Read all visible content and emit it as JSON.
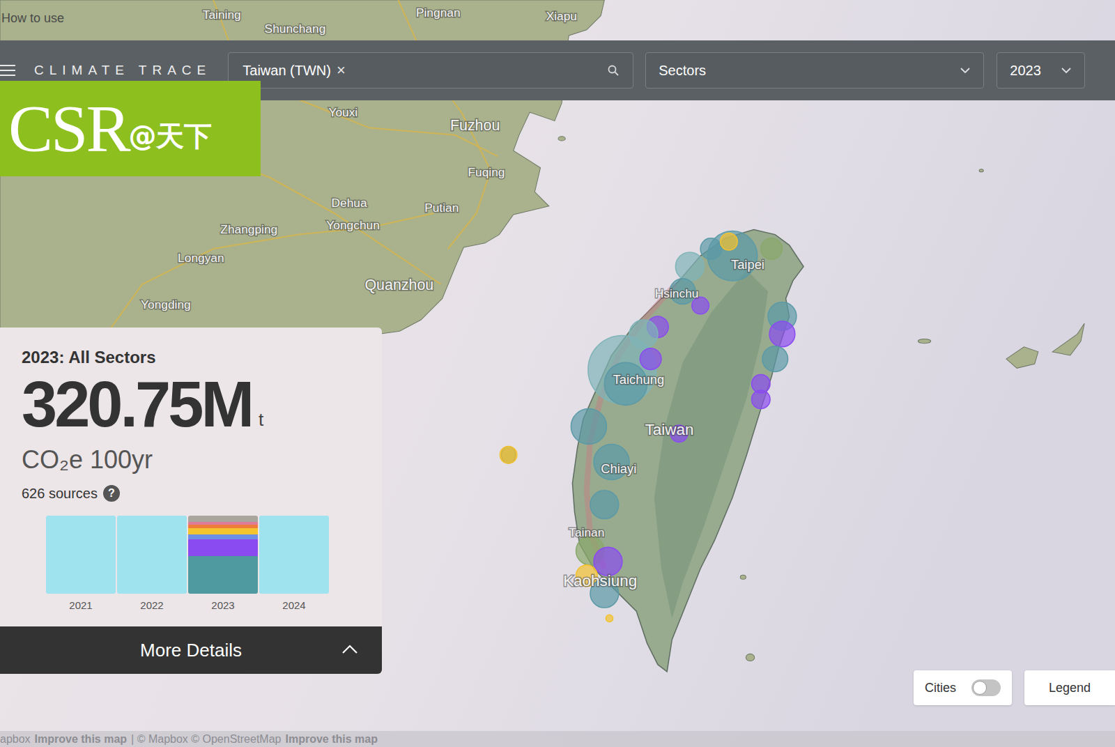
{
  "help_link": "How to use",
  "brand": {
    "name": "CLIMATE TRACE"
  },
  "search": {
    "value": "Taiwan (TWN)",
    "clear": "×"
  },
  "sector_select": {
    "value": "Sectors"
  },
  "year_select": {
    "value": "2023"
  },
  "watermark": {
    "main": "CSR",
    "suffix": "@天下"
  },
  "summary": {
    "title": "2023: All Sectors",
    "value": "320.75M",
    "unit": "t",
    "gas": "CO₂e 100yr",
    "sources": "626 sources",
    "help": "?"
  },
  "chart": {
    "bars": [
      {
        "year": "2021",
        "selected": false,
        "segments": [
          {
            "level": 1,
            "color": "#9fe3ee"
          }
        ]
      },
      {
        "year": "2022",
        "selected": false,
        "segments": [
          {
            "level": 1,
            "color": "#9fe3ee"
          }
        ]
      },
      {
        "year": "2023",
        "selected": true,
        "segments": [
          {
            "level": 0.48,
            "color": "#4f9aa0"
          },
          {
            "level": 0.22,
            "color": "#8a4cf0"
          },
          {
            "level": 0.06,
            "color": "#6b8fe6"
          },
          {
            "level": 0.08,
            "color": "#f4c430"
          },
          {
            "level": 0.04,
            "color": "#f07c3c"
          },
          {
            "level": 0.04,
            "color": "#e07a9a"
          },
          {
            "level": 0.08,
            "color": "#a9a79d"
          }
        ]
      },
      {
        "year": "2024",
        "selected": false,
        "segments": [
          {
            "level": 1,
            "color": "#9fe3ee"
          }
        ]
      }
    ]
  },
  "details_button": {
    "label": "More Details",
    "expanded": false
  },
  "map": {
    "places": [
      {
        "name": "Taining",
        "kind": "city"
      },
      {
        "name": "Shunchang",
        "kind": "city"
      },
      {
        "name": "Pingnan",
        "kind": "city"
      },
      {
        "name": "Xiapu",
        "kind": "city"
      },
      {
        "name": "Youxi",
        "kind": "city"
      },
      {
        "name": "Fuzhou",
        "kind": "major"
      },
      {
        "name": "Fuqing",
        "kind": "city"
      },
      {
        "name": "Dehua",
        "kind": "city"
      },
      {
        "name": "Putian",
        "kind": "city"
      },
      {
        "name": "Yongchun",
        "kind": "city"
      },
      {
        "name": "Zhangping",
        "kind": "city"
      },
      {
        "name": "Longyan",
        "kind": "city"
      },
      {
        "name": "Quanzhou",
        "kind": "major"
      },
      {
        "name": "Yongding",
        "kind": "city"
      },
      {
        "name": "Taipei",
        "kind": "island"
      },
      {
        "name": "Hsinchu",
        "kind": "city"
      },
      {
        "name": "Taichung",
        "kind": "island"
      },
      {
        "name": "Taiwan",
        "kind": "country"
      },
      {
        "name": "Chiayi",
        "kind": "island"
      },
      {
        "name": "Tainan",
        "kind": "city"
      },
      {
        "name": "Kaohsiung",
        "kind": "country"
      }
    ],
    "sources": [
      {
        "color": "#7fb4b8"
      },
      {
        "color": "#5b9aa6"
      },
      {
        "color": "#5b9aa6"
      },
      {
        "color": "#8aa86a"
      },
      {
        "color": "#f2c230"
      },
      {
        "color": "#8a4cf0"
      },
      {
        "color": "#5b9aa6"
      },
      {
        "color": "#8a4cf0"
      },
      {
        "color": "#7fb4b8"
      },
      {
        "color": "#7fb4b8"
      },
      {
        "color": "#5b9aa6"
      },
      {
        "color": "#8a4cf0"
      },
      {
        "color": "#5b9aa6"
      },
      {
        "color": "#8a4cf0"
      },
      {
        "color": "#5b9aa6"
      },
      {
        "color": "#8a4cf0"
      },
      {
        "color": "#8a4cf0"
      },
      {
        "color": "#5b9aa6"
      },
      {
        "color": "#8a4cf0"
      },
      {
        "color": "#5b9aa6"
      },
      {
        "color": "#5b9aa6"
      },
      {
        "color": "#8aa86a"
      },
      {
        "color": "#8a4cf0"
      },
      {
        "color": "#f2c230"
      },
      {
        "color": "#5b9aa6"
      },
      {
        "color": "#f2c230"
      },
      {
        "color": "#f2c230"
      }
    ]
  },
  "cities_toggle": {
    "label": "Cities",
    "on": false
  },
  "legend_button": {
    "label": "Legend"
  },
  "attribution": [
    {
      "text": "apbox",
      "bold": false
    },
    {
      "text": "Improve this map",
      "bold": true
    },
    {
      "text": "| © Mapbox © OpenStreetMap",
      "bold": false
    },
    {
      "text": "Improve this map",
      "bold": true
    }
  ]
}
